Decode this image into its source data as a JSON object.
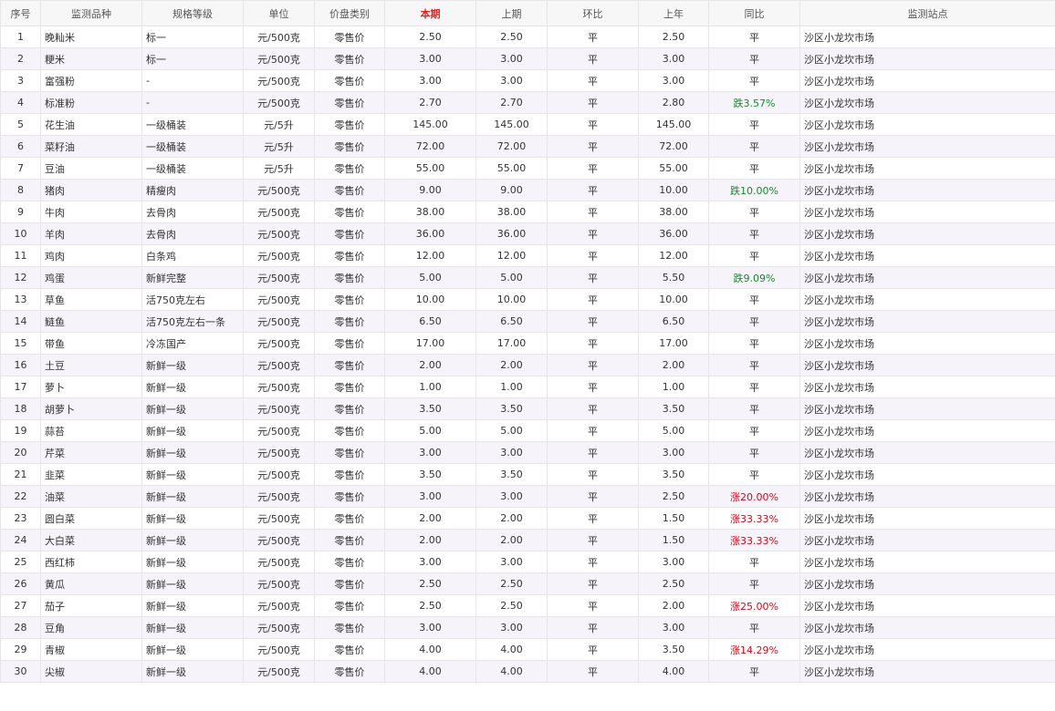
{
  "columns": [
    "序号",
    "监测品种",
    "规格等级",
    "单位",
    "价盘类别",
    "本期",
    "上期",
    "环比",
    "上年",
    "同比",
    "监测站点"
  ],
  "highlight_column": 5,
  "colors": {
    "highlight": "#ee1c1c",
    "rise": "#e60012",
    "fall": "#178a24",
    "alt_row": "#f6f3fb"
  },
  "rows": [
    [
      "1",
      "晚籼米",
      "标一",
      "元/500克",
      "零售价",
      "2.50",
      "2.50",
      "平",
      "2.50",
      "平",
      "沙区小龙坎市场"
    ],
    [
      "2",
      "粳米",
      "标一",
      "元/500克",
      "零售价",
      "3.00",
      "3.00",
      "平",
      "3.00",
      "平",
      "沙区小龙坎市场"
    ],
    [
      "3",
      "富强粉",
      "-",
      "元/500克",
      "零售价",
      "3.00",
      "3.00",
      "平",
      "3.00",
      "平",
      "沙区小龙坎市场"
    ],
    [
      "4",
      "标准粉",
      "-",
      "元/500克",
      "零售价",
      "2.70",
      "2.70",
      "平",
      "2.80",
      "跌3.57%",
      "沙区小龙坎市场"
    ],
    [
      "5",
      "花生油",
      "一级桶装",
      "元/5升",
      "零售价",
      "145.00",
      "145.00",
      "平",
      "145.00",
      "平",
      "沙区小龙坎市场"
    ],
    [
      "6",
      "菜籽油",
      "一级桶装",
      "元/5升",
      "零售价",
      "72.00",
      "72.00",
      "平",
      "72.00",
      "平",
      "沙区小龙坎市场"
    ],
    [
      "7",
      "豆油",
      "一级桶装",
      "元/5升",
      "零售价",
      "55.00",
      "55.00",
      "平",
      "55.00",
      "平",
      "沙区小龙坎市场"
    ],
    [
      "8",
      "猪肉",
      "精瘦肉",
      "元/500克",
      "零售价",
      "9.00",
      "9.00",
      "平",
      "10.00",
      "跌10.00%",
      "沙区小龙坎市场"
    ],
    [
      "9",
      "牛肉",
      "去骨肉",
      "元/500克",
      "零售价",
      "38.00",
      "38.00",
      "平",
      "38.00",
      "平",
      "沙区小龙坎市场"
    ],
    [
      "10",
      "羊肉",
      "去骨肉",
      "元/500克",
      "零售价",
      "36.00",
      "36.00",
      "平",
      "36.00",
      "平",
      "沙区小龙坎市场"
    ],
    [
      "11",
      "鸡肉",
      "白条鸡",
      "元/500克",
      "零售价",
      "12.00",
      "12.00",
      "平",
      "12.00",
      "平",
      "沙区小龙坎市场"
    ],
    [
      "12",
      "鸡蛋",
      "新鲜完整",
      "元/500克",
      "零售价",
      "5.00",
      "5.00",
      "平",
      "5.50",
      "跌9.09%",
      "沙区小龙坎市场"
    ],
    [
      "13",
      "草鱼",
      "活750克左右",
      "元/500克",
      "零售价",
      "10.00",
      "10.00",
      "平",
      "10.00",
      "平",
      "沙区小龙坎市场"
    ],
    [
      "14",
      "鲢鱼",
      "活750克左右一条",
      "元/500克",
      "零售价",
      "6.50",
      "6.50",
      "平",
      "6.50",
      "平",
      "沙区小龙坎市场"
    ],
    [
      "15",
      "带鱼",
      "冷冻国产",
      "元/500克",
      "零售价",
      "17.00",
      "17.00",
      "平",
      "17.00",
      "平",
      "沙区小龙坎市场"
    ],
    [
      "16",
      "土豆",
      "新鲜一级",
      "元/500克",
      "零售价",
      "2.00",
      "2.00",
      "平",
      "2.00",
      "平",
      "沙区小龙坎市场"
    ],
    [
      "17",
      "萝卜",
      "新鲜一级",
      "元/500克",
      "零售价",
      "1.00",
      "1.00",
      "平",
      "1.00",
      "平",
      "沙区小龙坎市场"
    ],
    [
      "18",
      "胡萝卜",
      "新鲜一级",
      "元/500克",
      "零售价",
      "3.50",
      "3.50",
      "平",
      "3.50",
      "平",
      "沙区小龙坎市场"
    ],
    [
      "19",
      "蒜苔",
      "新鲜一级",
      "元/500克",
      "零售价",
      "5.00",
      "5.00",
      "平",
      "5.00",
      "平",
      "沙区小龙坎市场"
    ],
    [
      "20",
      "芹菜",
      "新鲜一级",
      "元/500克",
      "零售价",
      "3.00",
      "3.00",
      "平",
      "3.00",
      "平",
      "沙区小龙坎市场"
    ],
    [
      "21",
      "韭菜",
      "新鲜一级",
      "元/500克",
      "零售价",
      "3.50",
      "3.50",
      "平",
      "3.50",
      "平",
      "沙区小龙坎市场"
    ],
    [
      "22",
      "油菜",
      "新鲜一级",
      "元/500克",
      "零售价",
      "3.00",
      "3.00",
      "平",
      "2.50",
      "涨20.00%",
      "沙区小龙坎市场"
    ],
    [
      "23",
      "圆白菜",
      "新鲜一级",
      "元/500克",
      "零售价",
      "2.00",
      "2.00",
      "平",
      "1.50",
      "涨33.33%",
      "沙区小龙坎市场"
    ],
    [
      "24",
      "大白菜",
      "新鲜一级",
      "元/500克",
      "零售价",
      "2.00",
      "2.00",
      "平",
      "1.50",
      "涨33.33%",
      "沙区小龙坎市场"
    ],
    [
      "25",
      "西红柿",
      "新鲜一级",
      "元/500克",
      "零售价",
      "3.00",
      "3.00",
      "平",
      "3.00",
      "平",
      "沙区小龙坎市场"
    ],
    [
      "26",
      "黄瓜",
      "新鲜一级",
      "元/500克",
      "零售价",
      "2.50",
      "2.50",
      "平",
      "2.50",
      "平",
      "沙区小龙坎市场"
    ],
    [
      "27",
      "茄子",
      "新鲜一级",
      "元/500克",
      "零售价",
      "2.50",
      "2.50",
      "平",
      "2.00",
      "涨25.00%",
      "沙区小龙坎市场"
    ],
    [
      "28",
      "豆角",
      "新鲜一级",
      "元/500克",
      "零售价",
      "3.00",
      "3.00",
      "平",
      "3.00",
      "平",
      "沙区小龙坎市场"
    ],
    [
      "29",
      "青椒",
      "新鲜一级",
      "元/500克",
      "零售价",
      "4.00",
      "4.00",
      "平",
      "3.50",
      "涨14.29%",
      "沙区小龙坎市场"
    ],
    [
      "30",
      "尖椒",
      "新鲜一级",
      "元/500克",
      "零售价",
      "4.00",
      "4.00",
      "平",
      "4.00",
      "平",
      "沙区小龙坎市场"
    ]
  ]
}
